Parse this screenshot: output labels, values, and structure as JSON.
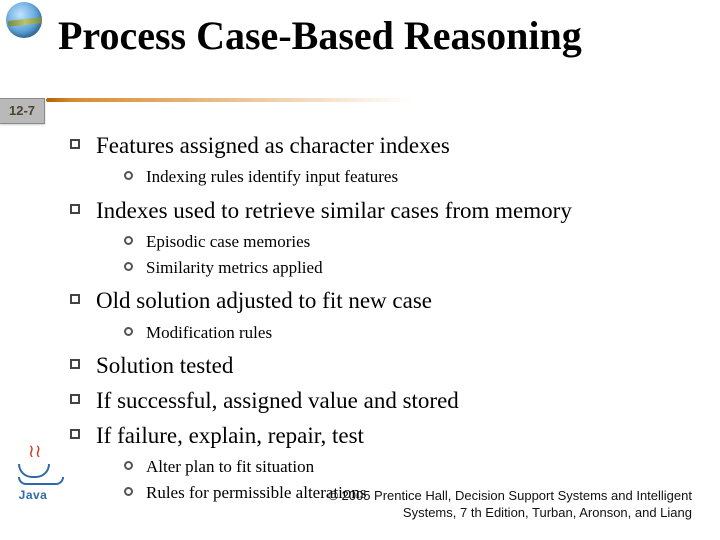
{
  "slide_number": "12-7",
  "title": "Process Case-Based Reasoning",
  "bullets": [
    {
      "text": "Features assigned as character indexes",
      "sub": [
        "Indexing rules identify input features"
      ]
    },
    {
      "text": "Indexes used to retrieve similar cases from memory",
      "sub": [
        "Episodic case memories",
        "Similarity metrics applied"
      ]
    },
    {
      "text": "Old solution adjusted to fit new case",
      "sub": [
        "Modification rules"
      ]
    },
    {
      "text": "Solution tested"
    },
    {
      "text": "If successful, assigned value and stored"
    },
    {
      "text": "If failure, explain, repair, test",
      "sub": [
        "Alter plan to fit situation",
        "Rules for permissible alterations"
      ]
    }
  ],
  "java_label": "Java",
  "copyright_line1": "© 2005  Prentice Hall, Decision Support Systems and Intelligent",
  "copyright_line2": "Systems, 7 th Edition, Turban, Aronson, and Liang"
}
